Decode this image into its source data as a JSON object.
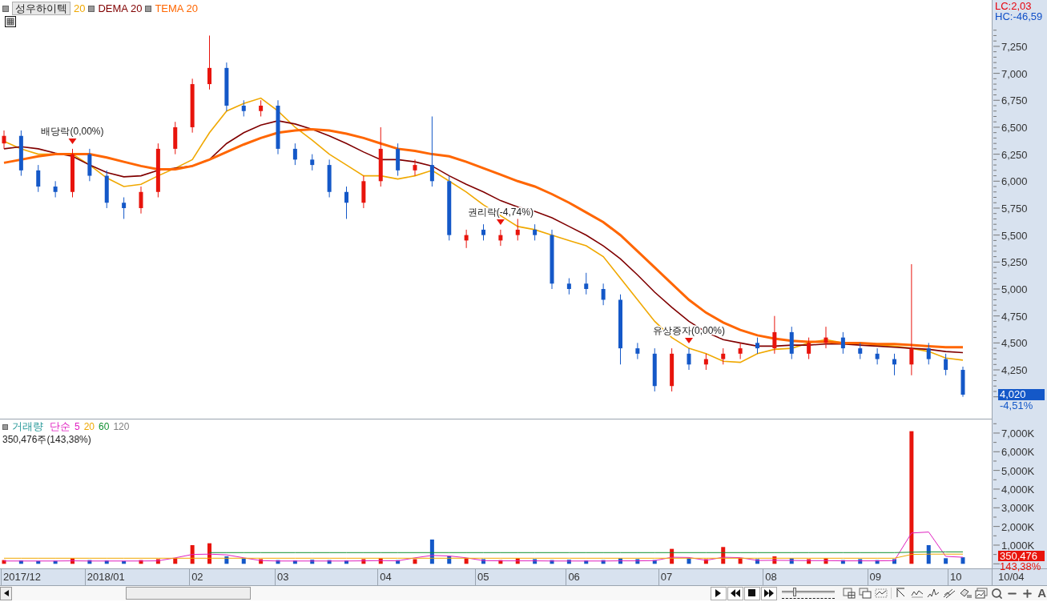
{
  "price_panel": {
    "stock_name": "성우하이텍",
    "chart_data": {
      "type": "candlestick",
      "categories": [
        null,
        null,
        null,
        null,
        null,
        null,
        null,
        null,
        null,
        null,
        null,
        null,
        null,
        null,
        null,
        null,
        null,
        null,
        null,
        null,
        null,
        null,
        null,
        null,
        null,
        null,
        null,
        null,
        null,
        null,
        null,
        null,
        null,
        null,
        null,
        null,
        null,
        null,
        null,
        null,
        null,
        null,
        null,
        null,
        null,
        null,
        null,
        null,
        null,
        null,
        null,
        null,
        null,
        null,
        null,
        null,
        null
      ],
      "ylim": [
        3790,
        7680
      ],
      "yticks": [
        {
          "value": 7250,
          "label": "7,250"
        },
        {
          "value": 7000,
          "label": "7,000"
        },
        {
          "value": 6750,
          "label": "6,750"
        },
        {
          "value": 6500,
          "label": "6,500"
        },
        {
          "value": 6250,
          "label": "6,250"
        },
        {
          "value": 6000,
          "label": "6,000"
        },
        {
          "value": 5750,
          "label": "5,750"
        },
        {
          "value": 5500,
          "label": "5,500"
        },
        {
          "value": 5250,
          "label": "5,250"
        },
        {
          "value": 5000,
          "label": "5,000"
        },
        {
          "value": 4750,
          "label": "4,750"
        },
        {
          "value": 4500,
          "label": "4,500"
        },
        {
          "value": 4250,
          "label": "4,250"
        }
      ],
      "ohlc": [
        [
          6350,
          6470,
          6300,
          6420
        ],
        [
          6420,
          6470,
          6050,
          6100
        ],
        [
          6100,
          6150,
          5900,
          5950
        ],
        [
          5950,
          6000,
          5850,
          5900
        ],
        [
          5900,
          6300,
          5850,
          6250
        ],
        [
          6250,
          6300,
          6000,
          6050
        ],
        [
          6050,
          6100,
          5750,
          5800
        ],
        [
          5800,
          5850,
          5650,
          5750
        ],
        [
          5750,
          5950,
          5700,
          5900
        ],
        [
          5900,
          6350,
          5850,
          6300
        ],
        [
          6300,
          6550,
          6250,
          6500
        ],
        [
          6500,
          6950,
          6450,
          6900
        ],
        [
          6900,
          7350,
          6850,
          7050
        ],
        [
          7050,
          7100,
          6650,
          6700
        ],
        [
          6700,
          6750,
          6600,
          6650
        ],
        [
          6650,
          6750,
          6600,
          6700
        ],
        [
          6700,
          6750,
          6250,
          6300
        ],
        [
          6300,
          6350,
          6150,
          6200
        ],
        [
          6200,
          6250,
          6100,
          6150
        ],
        [
          6150,
          6200,
          5850,
          5900
        ],
        [
          5900,
          5950,
          5650,
          5800
        ],
        [
          5800,
          6050,
          5750,
          6000
        ],
        [
          6000,
          6500,
          5950,
          6300
        ],
        [
          6300,
          6350,
          6050,
          6100
        ],
        [
          6100,
          6200,
          6050,
          6150
        ],
        [
          6150,
          6600,
          5950,
          6000
        ],
        [
          6000,
          6050,
          5450,
          5500
        ],
        [
          5450,
          5550,
          5380,
          5500
        ],
        [
          5550,
          5600,
          5450,
          5500
        ],
        [
          5450,
          5550,
          5400,
          5500
        ],
        [
          5500,
          5650,
          5450,
          5550
        ],
        [
          5550,
          5600,
          5450,
          5500
        ],
        [
          5500,
          5550,
          5000,
          5050
        ],
        [
          5050,
          5100,
          4950,
          5000
        ],
        [
          5050,
          5150,
          4950,
          5000
        ],
        [
          5000,
          5050,
          4850,
          4900
        ],
        [
          4900,
          4950,
          4300,
          4450
        ],
        [
          4450,
          4500,
          4350,
          4400
        ],
        [
          4400,
          4450,
          4050,
          4100
        ],
        [
          4100,
          4450,
          4050,
          4400
        ],
        [
          4400,
          4450,
          4250,
          4300
        ],
        [
          4300,
          4400,
          4250,
          4350
        ],
        [
          4350,
          4450,
          4300,
          4400
        ],
        [
          4400,
          4500,
          4350,
          4450
        ],
        [
          4500,
          4550,
          4400,
          4450
        ],
        [
          4450,
          4750,
          4400,
          4600
        ],
        [
          4600,
          4650,
          4350,
          4400
        ],
        [
          4400,
          4550,
          4350,
          4500
        ],
        [
          4500,
          4650,
          4450,
          4550
        ],
        [
          4550,
          4600,
          4400,
          4450
        ],
        [
          4450,
          4500,
          4350,
          4400
        ],
        [
          4400,
          4450,
          4300,
          4350
        ],
        [
          4350,
          4400,
          4200,
          4300
        ],
        [
          4300,
          5230,
          4200,
          4450
        ],
        [
          4450,
          4500,
          4300,
          4350
        ],
        [
          4350,
          4400,
          4200,
          4250
        ],
        [
          4250,
          4280,
          4000,
          4020
        ]
      ],
      "series": [
        {
          "name": "20",
          "type": "line",
          "color": "#f0a800",
          "values": [
            6370,
            6300,
            6250,
            6250,
            6250,
            6150,
            6030,
            5950,
            5970,
            6050,
            6120,
            6200,
            6450,
            6650,
            6720,
            6770,
            6650,
            6500,
            6380,
            6250,
            6150,
            6050,
            6050,
            6020,
            6050,
            6100,
            6000,
            5900,
            5780,
            5680,
            5580,
            5550,
            5500,
            5450,
            5400,
            5300,
            5100,
            4900,
            4700,
            4550,
            4450,
            4400,
            4330,
            4320,
            4400,
            4440,
            4450,
            4500,
            4530,
            4500,
            4500,
            4480,
            4470,
            4450,
            4420,
            4360,
            4340
          ]
        },
        {
          "name": "DEMA 20",
          "type": "line",
          "color": "#800000",
          "values": [
            6300,
            6320,
            6300,
            6260,
            6230,
            6150,
            6080,
            6040,
            6050,
            6100,
            6120,
            6140,
            6200,
            6350,
            6450,
            6520,
            6560,
            6530,
            6480,
            6420,
            6350,
            6270,
            6200,
            6200,
            6180,
            6140,
            6050,
            5970,
            5900,
            5820,
            5760,
            5720,
            5660,
            5580,
            5500,
            5400,
            5280,
            5130,
            4970,
            4830,
            4700,
            4600,
            4530,
            4500,
            4470,
            4470,
            4480,
            4480,
            4490,
            4490,
            4480,
            4470,
            4460,
            4450,
            4440,
            4420,
            4410
          ]
        },
        {
          "name": "TEMA 20",
          "type": "line",
          "color": "#ff6600",
          "values": [
            6170,
            6200,
            6230,
            6250,
            6250,
            6250,
            6220,
            6180,
            6140,
            6110,
            6110,
            6140,
            6200,
            6270,
            6340,
            6400,
            6450,
            6470,
            6480,
            6470,
            6440,
            6400,
            6350,
            6300,
            6280,
            6250,
            6230,
            6180,
            6120,
            6060,
            6000,
            5950,
            5880,
            5800,
            5710,
            5620,
            5500,
            5350,
            5200,
            5050,
            4900,
            4780,
            4690,
            4620,
            4570,
            4540,
            4520,
            4510,
            4510,
            4500,
            4500,
            4490,
            4490,
            4480,
            4470,
            4460,
            4460
          ]
        }
      ]
    },
    "events": [
      {
        "label": "배당락(0,00%)"
      },
      {
        "label": "권리락(-4,74%)"
      },
      {
        "label": "유상증자(0,00%)"
      }
    ],
    "stats": [
      {
        "label": "LC:2,03",
        "color": "#e8000b"
      },
      {
        "label": "HC:-46,59",
        "color": "#1050c8"
      }
    ],
    "current": {
      "price": "4,020",
      "change": "-4,51%"
    }
  },
  "volume_panel": {
    "title": "거래량",
    "ma_type": "단순",
    "chart_data": {
      "type": "bar",
      "categories": [
        null,
        null,
        null,
        null,
        null,
        null,
        null,
        null,
        null,
        null,
        null,
        null,
        null,
        null,
        null,
        null,
        null,
        null,
        null,
        null,
        null,
        null,
        null,
        null,
        null,
        null,
        null,
        null,
        null,
        null,
        null,
        null,
        null,
        null,
        null,
        null,
        null,
        null,
        null,
        null,
        null,
        null,
        null,
        null,
        null,
        null,
        null,
        null,
        null,
        null,
        null,
        null,
        null,
        null,
        null,
        null,
        null
      ],
      "ylim": [
        0,
        7500
      ],
      "yticks": [
        {
          "value": 7000,
          "label": "7,000K"
        },
        {
          "value": 6000,
          "label": "6,000K"
        },
        {
          "value": 5000,
          "label": "5,000K"
        },
        {
          "value": 4000,
          "label": "4,000K"
        },
        {
          "value": 3000,
          "label": "3,000K"
        },
        {
          "value": 2000,
          "label": "2,000K"
        },
        {
          "value": 1000,
          "label": "1,000K"
        }
      ],
      "series": [
        {
          "values": [
            200,
            180,
            150,
            160,
            300,
            200,
            180,
            150,
            200,
            250,
            300,
            1000,
            1100,
            400,
            300,
            250,
            200,
            180,
            220,
            200,
            180,
            250,
            300,
            200,
            250,
            1300,
            400,
            300,
            250,
            200,
            300,
            250,
            200,
            220,
            180,
            200,
            300,
            250,
            200,
            800,
            300,
            250,
            900,
            300,
            250,
            400,
            300,
            250,
            300,
            200,
            250,
            200,
            250,
            7100,
            1000,
            300,
            350
          ],
          "colors": [
            "#e8140c",
            "#1458c8",
            "#1458c8",
            "#1458c8",
            "#e8140c",
            "#1458c8",
            "#1458c8",
            "#1458c8",
            "#e8140c",
            "#e8140c",
            "#e8140c",
            "#e8140c",
            "#e8140c",
            "#1458c8",
            "#1458c8",
            "#e8140c",
            "#1458c8",
            "#1458c8",
            "#1458c8",
            "#1458c8",
            "#1458c8",
            "#e8140c",
            "#e8140c",
            "#1458c8",
            "#e8140c",
            "#1458c8",
            "#1458c8",
            "#e8140c",
            "#1458c8",
            "#e8140c",
            "#e8140c",
            "#1458c8",
            "#1458c8",
            "#1458c8",
            "#1458c8",
            "#1458c8",
            "#1458c8",
            "#1458c8",
            "#1458c8",
            "#e8140c",
            "#1458c8",
            "#e8140c",
            "#e8140c",
            "#e8140c",
            "#1458c8",
            "#e8140c",
            "#1458c8",
            "#e8140c",
            "#e8140c",
            "#1458c8",
            "#1458c8",
            "#1458c8",
            "#1458c8",
            "#e8140c",
            "#1458c8",
            "#1458c8",
            "#1458c8"
          ]
        },
        {
          "name": "5",
          "type": "line",
          "color": "#e020c0",
          "values": [
            150,
            150,
            150,
            150,
            160,
            150,
            150,
            150,
            150,
            160,
            320,
            500,
            520,
            480,
            320,
            170,
            150,
            150,
            150,
            150,
            150,
            160,
            170,
            160,
            320,
            450,
            420,
            320,
            170,
            160,
            160,
            160,
            150,
            150,
            150,
            150,
            160,
            160,
            170,
            350,
            340,
            190,
            350,
            330,
            180,
            190,
            180,
            170,
            170,
            160,
            160,
            160,
            170,
            1650,
            1700,
            400,
            350
          ]
        },
        {
          "name": "20",
          "type": "line",
          "color": "#f0a800",
          "values": [
            300,
            300,
            300,
            300,
            300,
            300,
            300,
            300,
            300,
            300,
            300,
            300,
            300,
            300,
            300,
            300,
            300,
            300,
            300,
            300,
            300,
            300,
            300,
            300,
            300,
            300,
            300,
            300,
            300,
            300,
            300,
            300,
            300,
            300,
            300,
            300,
            300,
            300,
            300,
            300,
            300,
            300,
            300,
            300,
            300,
            300,
            300,
            300,
            300,
            300,
            300,
            300,
            300,
            500,
            520,
            520,
            520
          ]
        },
        {
          "name": "60",
          "type": "line",
          "color": "#109030",
          "values": [
            null,
            null,
            null,
            null,
            null,
            null,
            null,
            null,
            null,
            null,
            null,
            null,
            600,
            600,
            600,
            600,
            600,
            600,
            600,
            600,
            600,
            600,
            600,
            600,
            600,
            600,
            600,
            600,
            600,
            600,
            600,
            600,
            600,
            600,
            600,
            600,
            600,
            600,
            600,
            600,
            600,
            600,
            600,
            600,
            600,
            600,
            600,
            600,
            600,
            600,
            600,
            600,
            600,
            620,
            640,
            640,
            640
          ]
        },
        {
          "name": "120",
          "type": "line",
          "color": "#808080",
          "values": [
            null,
            null,
            null,
            null,
            null,
            null,
            null,
            null,
            null,
            null,
            null,
            null,
            null,
            null,
            null,
            null,
            null,
            null,
            null,
            null,
            null,
            null,
            null,
            null,
            null,
            null,
            null,
            null,
            null,
            null,
            null,
            null,
            null,
            null,
            null,
            null,
            null,
            null,
            null,
            null,
            null,
            null,
            null,
            null,
            null,
            null,
            null,
            null,
            null,
            null,
            null,
            null,
            null,
            null,
            null,
            null,
            null
          ]
        }
      ]
    },
    "summary": "350,476주(143,38%)",
    "current": {
      "volume": "350,476",
      "change": "143,38%"
    }
  },
  "date_axis": {
    "labels": [
      "2017/12",
      "2018/01",
      "02",
      "03",
      "04",
      "05",
      "06",
      "07",
      "08",
      "09",
      "10"
    ],
    "last_date": "10/04"
  },
  "toolbar": {
    "zoom_slider": {
      "level": 0.2
    },
    "font_button": "A"
  }
}
